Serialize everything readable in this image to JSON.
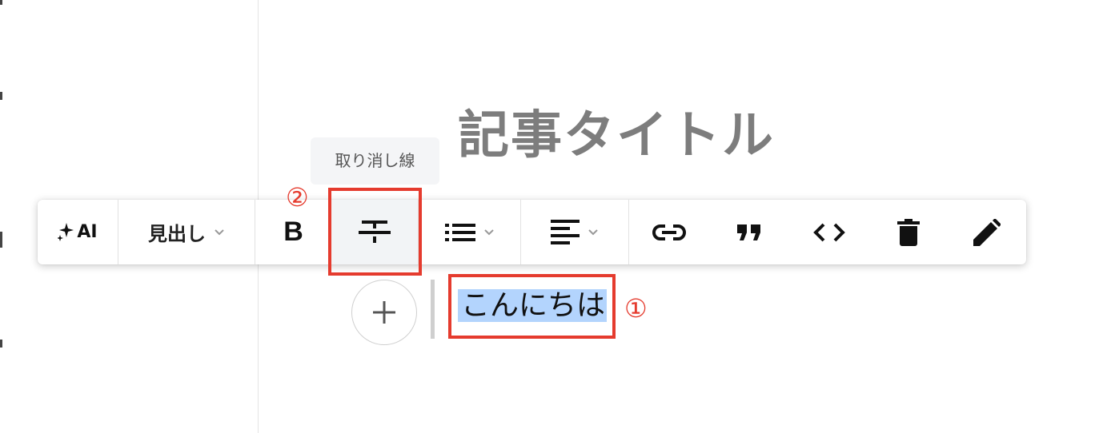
{
  "page": {
    "title": "記事タイトル",
    "tooltip": "取り消し線"
  },
  "toolbar": {
    "ai_label": "AI",
    "heading_label": "見出し",
    "bold_label": "B",
    "buttons": [
      {
        "name": "ai",
        "icon": "sparkles-icon"
      },
      {
        "name": "heading",
        "icon": "chevron-down-icon"
      },
      {
        "name": "bold",
        "icon": "bold-icon"
      },
      {
        "name": "strikethrough",
        "icon": "strikethrough-icon",
        "active": true
      },
      {
        "name": "list",
        "icon": "list-icon"
      },
      {
        "name": "align",
        "icon": "align-left-icon"
      },
      {
        "name": "link",
        "icon": "link-icon"
      },
      {
        "name": "quote",
        "icon": "quote-icon"
      },
      {
        "name": "code",
        "icon": "code-icon"
      },
      {
        "name": "delete",
        "icon": "trash-icon"
      },
      {
        "name": "edit",
        "icon": "pencil-icon"
      }
    ]
  },
  "editor": {
    "add_button_icon": "plus-icon",
    "selected_text": "こんにちは"
  },
  "annotations": {
    "step1": "①",
    "step2": "②",
    "color": "#e53b2e"
  },
  "colors": {
    "selection": "#b3d4fd",
    "title": "#7d7d7d"
  }
}
